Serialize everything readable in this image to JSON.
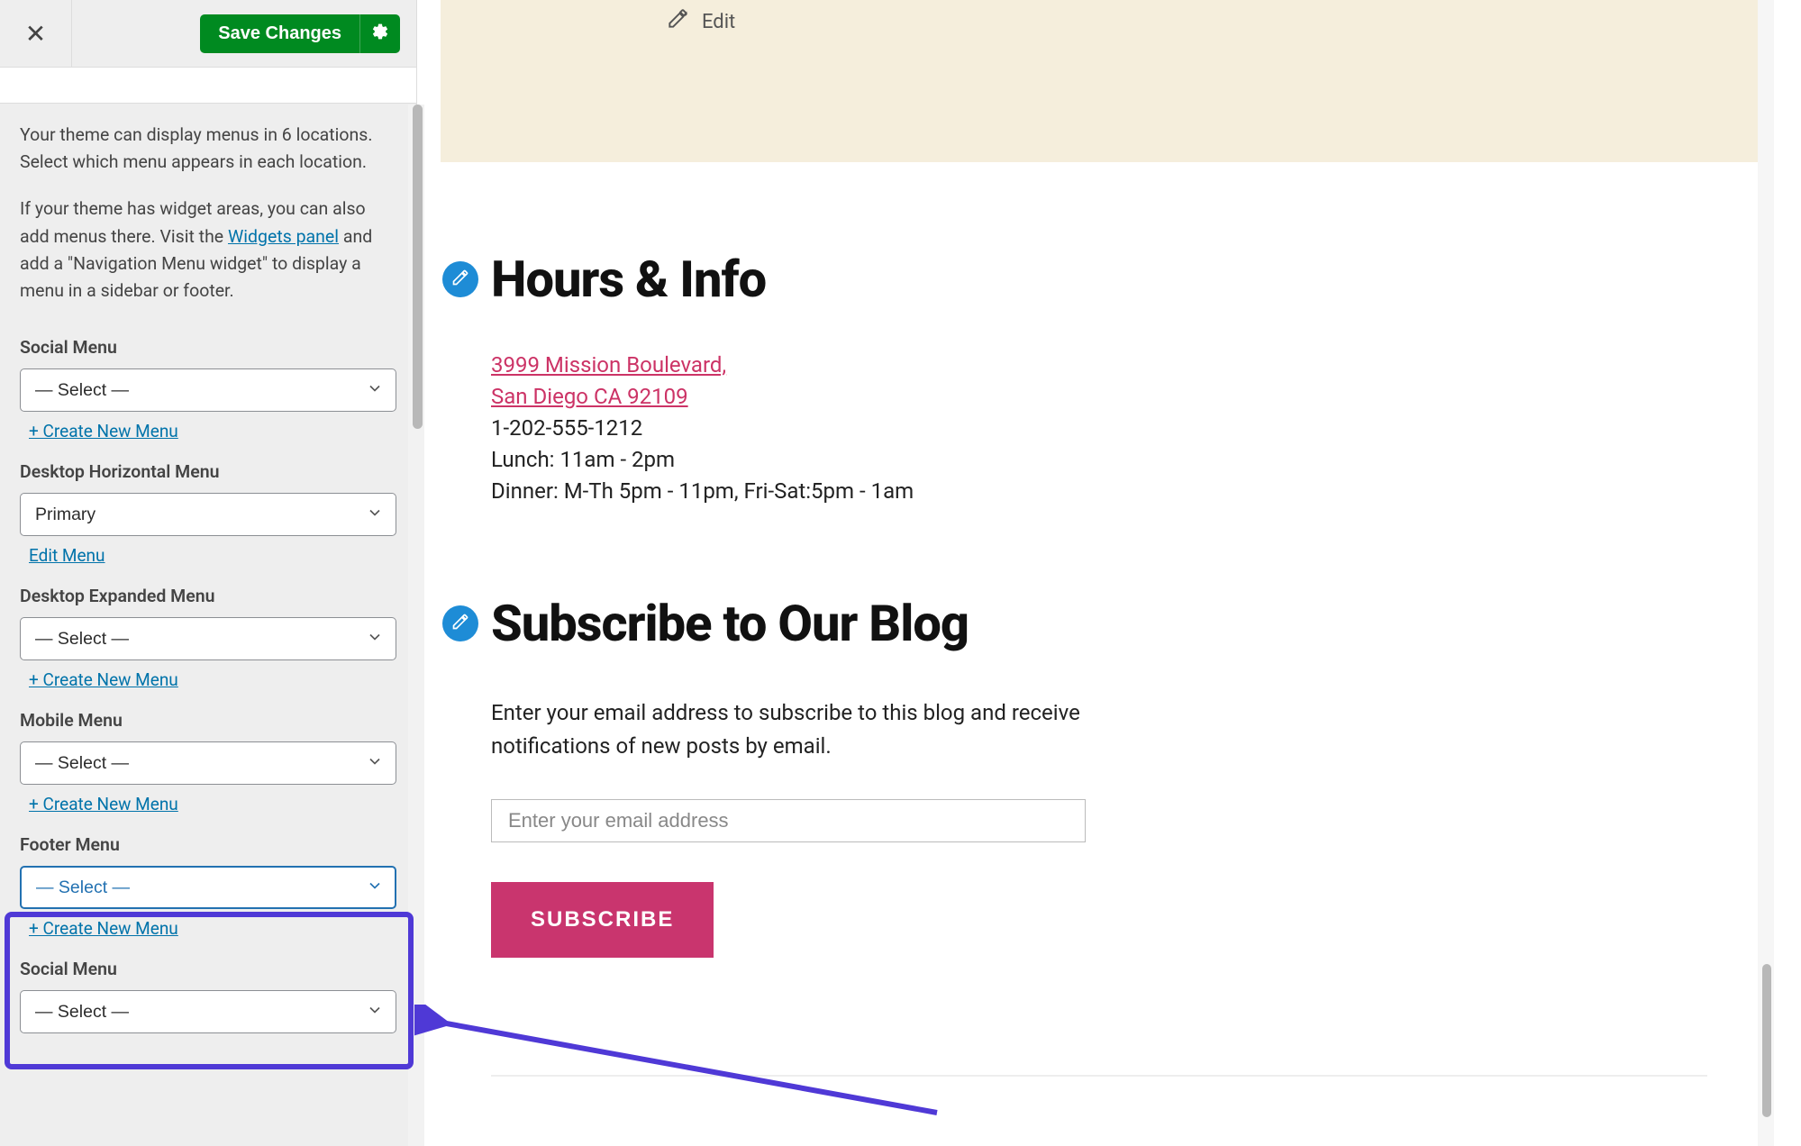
{
  "sidebar": {
    "save_label": "Save Changes",
    "desc1": "Your theme can display menus in 6 locations. Select which menu appears in each location.",
    "desc2_a": "If your theme has widget areas, you can also add menus there. Visit the ",
    "widgets_link": "Widgets panel",
    "desc2_b": " and add a \"Navigation Menu widget\" to display a menu in a sidebar or footer.",
    "create_new": "+ Create New Menu",
    "edit_menu": "Edit Menu",
    "select_placeholder": "— Select —",
    "locations": {
      "social1": {
        "label": "Social Menu",
        "value": "— Select —"
      },
      "desktop_h": {
        "label": "Desktop Horizontal Menu",
        "value": "Primary"
      },
      "desktop_e": {
        "label": "Desktop Expanded Menu",
        "value": "— Select —"
      },
      "mobile": {
        "label": "Mobile Menu",
        "value": "— Select —"
      },
      "footer": {
        "label": "Footer Menu",
        "value": "— Select —"
      },
      "social2": {
        "label": "Social Menu",
        "value": "— Select —"
      }
    }
  },
  "preview": {
    "edit_label": "Edit",
    "hours": {
      "title": "Hours & Info",
      "address1": "3999 Mission Boulevard,",
      "address2": "San Diego CA 92109",
      "phone": "1-202-555-1212",
      "lunch": "Lunch: 11am - 2pm",
      "dinner": "Dinner: M-Th 5pm - 11pm, Fri-Sat:5pm - 1am"
    },
    "subscribe": {
      "title": "Subscribe to Our Blog",
      "desc": "Enter your email address to subscribe to this blog and receive notifications of new posts by email.",
      "placeholder": "Enter your email address",
      "button": "SUBSCRIBE"
    }
  }
}
